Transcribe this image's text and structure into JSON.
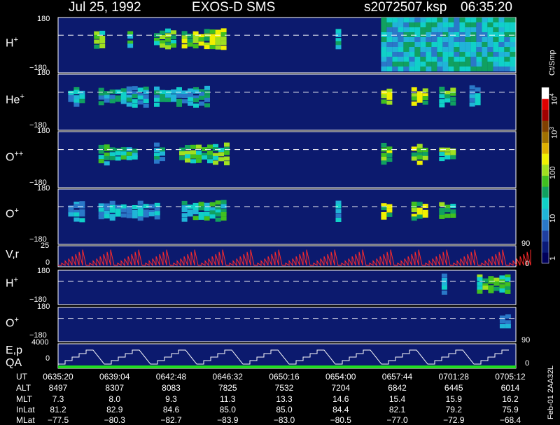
{
  "header": {
    "date": "Jul 25, 1992",
    "instrument": "EXOS-D SMS",
    "file": "s2072507.ksp",
    "time": "06:35:20"
  },
  "panels": [
    {
      "label": "H",
      "sup": "+",
      "top_tick": "180",
      "bottom_tick": "−180"
    },
    {
      "label": "He",
      "sup": "+",
      "top_tick": "180",
      "bottom_tick": "−180"
    },
    {
      "label": "O",
      "sup": "++",
      "top_tick": "180",
      "bottom_tick": "−180"
    },
    {
      "label": "O",
      "sup": "+",
      "top_tick": "180",
      "bottom_tick": "−180"
    },
    {
      "label": "V",
      "sup": "",
      "label2": ",r",
      "top_tick": "25",
      "bottom_tick": "0",
      "right_top": "90",
      "right_bottom": "0"
    },
    {
      "label": "H",
      "sup": "+",
      "top_tick": "180",
      "bottom_tick": "−180"
    },
    {
      "label": "O",
      "sup": "+",
      "top_tick": "180",
      "bottom_tick": "−180",
      "right_bottom": "90"
    },
    {
      "label": "E,p",
      "label_b": "QA",
      "top_tick": "4000",
      "bottom_tick": "0",
      "right_bottom": "0"
    }
  ],
  "colorbar": {
    "unit": "Ct/Smp",
    "ticks": [
      "1",
      "10",
      "100",
      "10",
      "10"
    ],
    "tick_sups": [
      "",
      "",
      "",
      "3",
      "4"
    ],
    "colors": [
      "#00005a",
      "#0a1a78",
      "#1f3fa0",
      "#2a78c8",
      "#20b4d8",
      "#10d0c8",
      "#10a060",
      "#40c020",
      "#a0e020",
      "#f0f000",
      "#e0b000",
      "#a07000",
      "#804000",
      "#a00000",
      "#e00000",
      "#ffffff"
    ]
  },
  "footer_id": "Feb-01 2AA32L",
  "table": {
    "row_labels": [
      "UT",
      "ALT",
      "MLT",
      "InLat",
      "MLat"
    ],
    "columns": [
      {
        "UT": "0635:20",
        "ALT": "8497",
        "MLT": "7.3",
        "InLat": "81.2",
        "MLat": "−77.5"
      },
      {
        "UT": "0639:04",
        "ALT": "8307",
        "MLT": "8.0",
        "InLat": "82.9",
        "MLat": "−80.3"
      },
      {
        "UT": "0642:48",
        "ALT": "8083",
        "MLT": "9.3",
        "InLat": "84.6",
        "MLat": "−82.7"
      },
      {
        "UT": "0646:32",
        "ALT": "7825",
        "MLT": "11.3",
        "InLat": "85.0",
        "MLat": "−83.9"
      },
      {
        "UT": "0650:16",
        "ALT": "7532",
        "MLT": "13.3",
        "InLat": "85.0",
        "MLat": "−83.0"
      },
      {
        "UT": "0654:00",
        "ALT": "7204",
        "MLT": "14.6",
        "InLat": "84.4",
        "MLat": "−80.5"
      },
      {
        "UT": "0657:44",
        "ALT": "6842",
        "MLT": "15.4",
        "InLat": "82.1",
        "MLat": "−77.0"
      },
      {
        "UT": "0701:28",
        "ALT": "6445",
        "MLT": "15.9",
        "InLat": "79.2",
        "MLat": "−72.9"
      },
      {
        "UT": "0705:12",
        "ALT": "6014",
        "MLT": "16.2",
        "InLat": "75.9",
        "MLat": "−68.4"
      }
    ]
  },
  "chart_data": {
    "type": "heatmap",
    "title": "Jul 25, 1992   EXOS-D SMS",
    "x_ticks": [
      "0635:20",
      "0639:04",
      "0642:48",
      "0646:32",
      "0650:16",
      "0654:00",
      "0657:44",
      "0701:28",
      "0705:12"
    ],
    "ylabel_ticks": {
      "pitch": [
        -180,
        180
      ],
      "Vr": [
        0,
        25
      ],
      "Ep": [
        0,
        4000
      ]
    },
    "colorbar_ticks": [
      "1",
      "10",
      "100",
      "10^3",
      "10^4"
    ],
    "colorbar_unit": "Ct/Smp",
    "series": [
      {
        "name": "H+",
        "patches": [
          {
            "x0": "0637:42",
            "x1": "0638:24",
            "level": 8
          },
          {
            "x0": "0639:55",
            "x1": "0640:10",
            "level": 7
          },
          {
            "x0": "0641:40",
            "x1": "0643:00",
            "level": 8
          },
          {
            "x0": "0643:30",
            "x1": "0646:20",
            "level": 9
          },
          {
            "x0": "0653:40",
            "x1": "0654:00",
            "level": 7
          },
          {
            "x0": "0656:40",
            "x1": "0705:20",
            "level": 6
          }
        ]
      },
      {
        "name": "He+",
        "patches": [
          {
            "x0": "0636:00",
            "x1": "0637:00",
            "level": 6
          },
          {
            "x0": "0638:00",
            "x1": "0641:00",
            "level": 6
          },
          {
            "x0": "0641:40",
            "x1": "0645:00",
            "level": 6
          },
          {
            "x0": "0656:40",
            "x1": "0657:20",
            "level": 9
          },
          {
            "x0": "0658:40",
            "x1": "0659:40",
            "level": 9
          },
          {
            "x0": "0700:30",
            "x1": "0701:20",
            "level": 8
          },
          {
            "x0": "0702:30",
            "x1": "0703:00",
            "level": 6
          }
        ]
      },
      {
        "name": "O++",
        "patches": [
          {
            "x0": "0638:00",
            "x1": "0640:20",
            "level": 7
          },
          {
            "x0": "0641:40",
            "x1": "0642:20",
            "level": 6
          },
          {
            "x0": "0643:20",
            "x1": "0646:20",
            "level": 8
          },
          {
            "x0": "0656:40",
            "x1": "0657:20",
            "level": 9
          },
          {
            "x0": "0658:40",
            "x1": "0659:40",
            "level": 9
          },
          {
            "x0": "0700:30",
            "x1": "0701:20",
            "level": 8
          }
        ]
      },
      {
        "name": "O+",
        "patches": [
          {
            "x0": "0636:00",
            "x1": "0637:00",
            "level": 5
          },
          {
            "x0": "0638:00",
            "x1": "0642:00",
            "level": 5
          },
          {
            "x0": "0643:30",
            "x1": "0646:20",
            "level": 7
          },
          {
            "x0": "0653:40",
            "x1": "0654:00",
            "level": 5
          },
          {
            "x0": "0656:40",
            "x1": "0657:20",
            "level": 9
          },
          {
            "x0": "0658:40",
            "x1": "0659:40",
            "level": 9
          },
          {
            "x0": "0700:30",
            "x1": "0701:20",
            "level": 8
          }
        ]
      },
      {
        "name": "H+ (lower)",
        "patches": [
          {
            "x0": "0700:40",
            "x1": "0701:00",
            "level": 5
          },
          {
            "x0": "0703:00",
            "x1": "0705:00",
            "level": 8
          }
        ]
      },
      {
        "name": "O+ (lower)",
        "patches": [
          {
            "x0": "0704:30",
            "x1": "0705:00",
            "level": 4
          }
        ]
      }
    ]
  }
}
